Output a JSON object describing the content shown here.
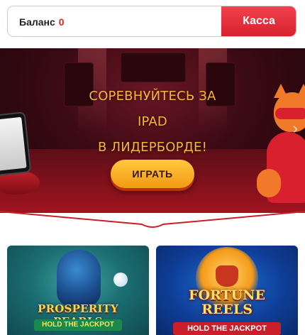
{
  "balance": {
    "label": "Баланс",
    "value": "0",
    "kassa_label": "Касса"
  },
  "banner": {
    "title_lines": [
      "СОРЕВНУЙТЕСЬ ЗА",
      "IPAD",
      "В ЛИДЕРБОРДЕ!"
    ],
    "play_label": "ИГРАТЬ",
    "next_icon": "chevron-right-icon"
  },
  "games": [
    {
      "title": "PROSPERITY PEARLS",
      "subtitle": "HOLD THE JACKPOT"
    },
    {
      "title_lines": [
        "FORTUNE",
        "REELS"
      ],
      "subtitle": "HOLD THE JACKPOT"
    }
  ],
  "colors": {
    "accent_red": "#d81f2c",
    "balance_value": "#d9262b",
    "banner_text": "#f7b43a",
    "play_button": "#f29a12"
  }
}
